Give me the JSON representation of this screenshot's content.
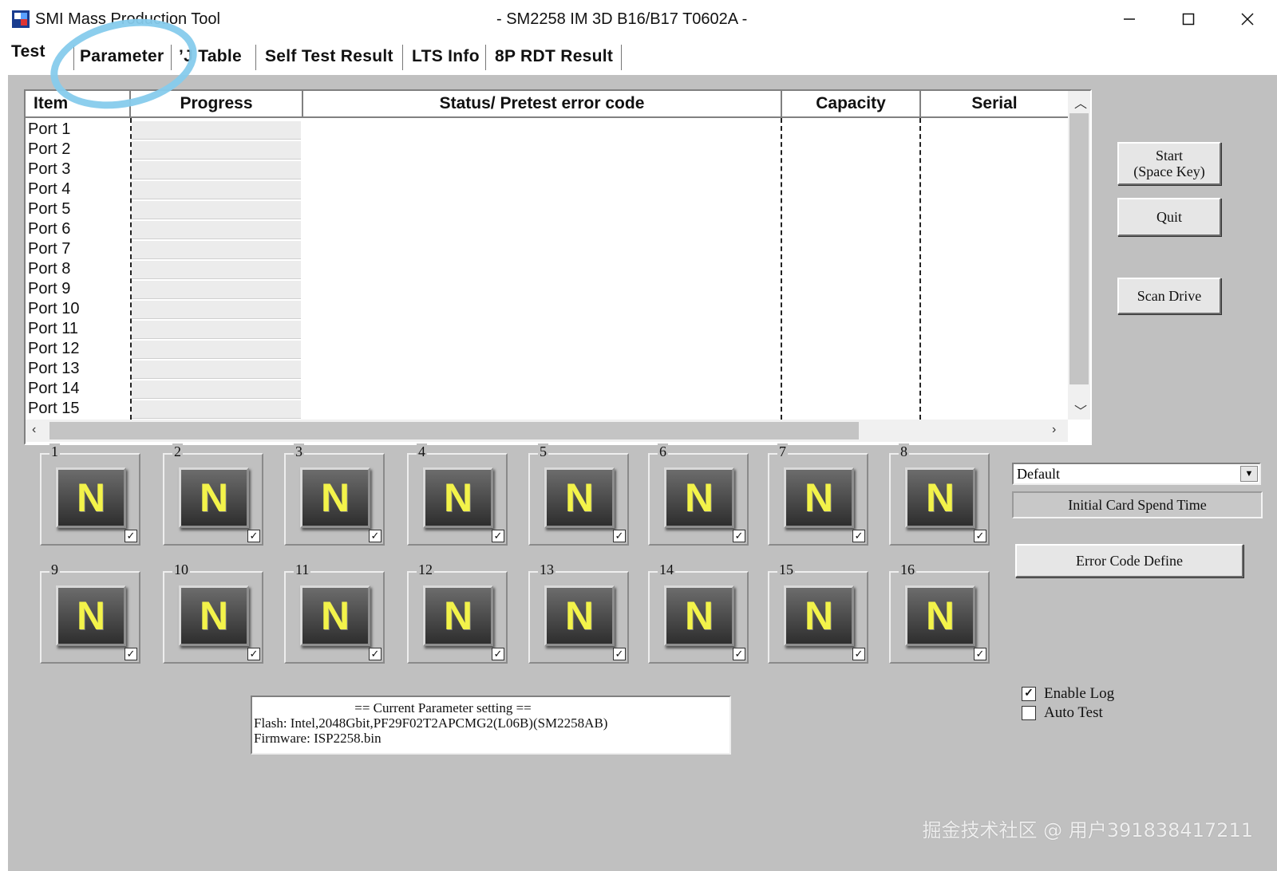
{
  "window": {
    "app_title": "SMI Mass Production Tool",
    "doc_title": "- SM2258 IM 3D B16/B17 T0602A -"
  },
  "tabs": [
    "Test",
    "Parameter",
    "’J Table",
    "Self Test Result",
    "LTS Info",
    "8P RDT Result"
  ],
  "list": {
    "headers": [
      "Item",
      "Progress",
      "Status/ Pretest error code",
      "Capacity",
      "Serial"
    ],
    "rows": [
      "Port 1",
      "Port 2",
      "Port 3",
      "Port 4",
      "Port 5",
      "Port 6",
      "Port 7",
      "Port 8",
      "Port 9",
      "Port 10",
      "Port 11",
      "Port 12",
      "Port 13",
      "Port 14",
      "Port 15"
    ]
  },
  "buttons": {
    "start_line1": "Start",
    "start_line2": "(Space Key)",
    "quit": "Quit",
    "scan": "Scan Drive",
    "error_code": "Error Code Define"
  },
  "ports": [
    {
      "num": "1",
      "letter": "N",
      "checked": true
    },
    {
      "num": "2",
      "letter": "N",
      "checked": true
    },
    {
      "num": "3",
      "letter": "N",
      "checked": true
    },
    {
      "num": "4",
      "letter": "N",
      "checked": true
    },
    {
      "num": "5",
      "letter": "N",
      "checked": true
    },
    {
      "num": "6",
      "letter": "N",
      "checked": true
    },
    {
      "num": "7",
      "letter": "N",
      "checked": true
    },
    {
      "num": "8",
      "letter": "N",
      "checked": true
    },
    {
      "num": "9",
      "letter": "N",
      "checked": true
    },
    {
      "num": "10",
      "letter": "N",
      "checked": true
    },
    {
      "num": "11",
      "letter": "N",
      "checked": true
    },
    {
      "num": "12",
      "letter": "N",
      "checked": true
    },
    {
      "num": "13",
      "letter": "N",
      "checked": true
    },
    {
      "num": "14",
      "letter": "N",
      "checked": true
    },
    {
      "num": "15",
      "letter": "N",
      "checked": true
    },
    {
      "num": "16",
      "letter": "N",
      "checked": true
    }
  ],
  "combo": {
    "value": "Default"
  },
  "spend_time_label": "Initial Card Spend Time",
  "options": {
    "enable_log": {
      "label": "Enable Log",
      "checked": true
    },
    "auto_test": {
      "label": "Auto Test",
      "checked": false
    }
  },
  "param": {
    "heading": "== Current Parameter setting ==",
    "flash": "Flash:   Intel,2048Gbit,PF29F02T2APCMG2(L06B)(SM2258AB)",
    "firmware": "Firmware:   ISP2258.bin"
  },
  "watermark": "掘金技术社区 @ 用户391838417211",
  "colors": {
    "panel": "#c0c0c0",
    "highlight_ring": "#86cbec",
    "port_letter": "#f3f34a"
  }
}
